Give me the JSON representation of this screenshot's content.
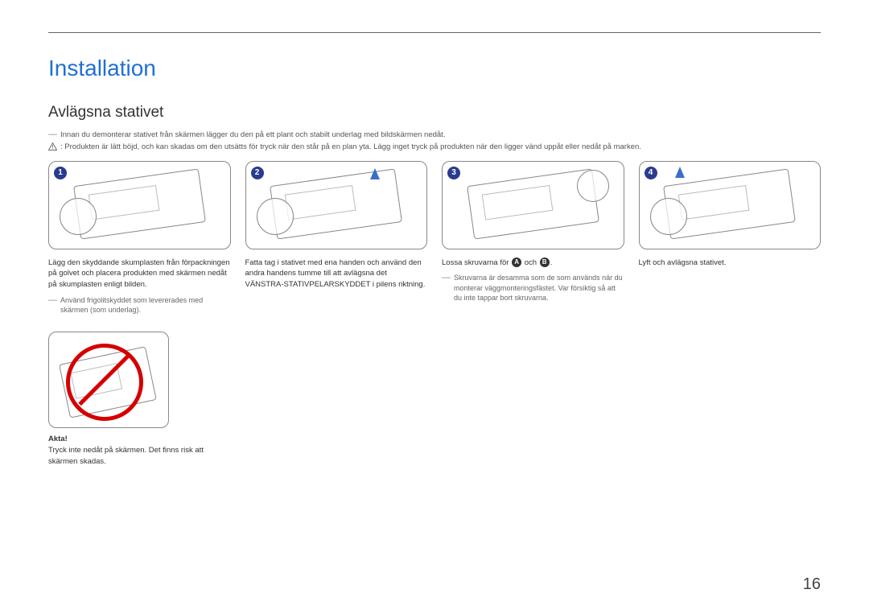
{
  "title": "Installation",
  "subtitle": "Avlägsna stativet",
  "intro_note": "Innan du demonterar stativet från skärmen lägger du den på ett plant och stabilt underlag med bildskärmen nedåt.",
  "intro_warning": ": Produkten är lätt böjd, och kan skadas om den utsätts för tryck när den står på en plan yta. Lägg inget tryck på produkten när den ligger vänd uppåt eller nedåt på marken.",
  "steps": {
    "s1": {
      "num": "1",
      "text": "Lägg den skyddande skumplasten från förpackningen på golvet och placera produkten med skärmen nedåt på skumplasten enligt bilden.",
      "note": "Använd frigolitskyddet som levererades med skärmen (som underlag)."
    },
    "s2": {
      "num": "2",
      "text": "Fatta tag i stativet med ena handen och använd den andra handens tumme till att avlägsna det VÄNSTRA-STATIVPELARSKYDDET i pilens riktning."
    },
    "s3": {
      "num": "3",
      "text_before": "Lossa skruvarna för ",
      "a": "A",
      "mid": " och ",
      "b": "B",
      "text_after": ".",
      "note": "Skruvarna är desamma som de som används när du monterar väggmonteringsfästet. Var försiktig så att du inte tappar bort skruvarna."
    },
    "s4": {
      "num": "4",
      "text": "Lyft och avlägsna stativet."
    }
  },
  "caution": {
    "label": "Akta!",
    "text": "Tryck inte nedåt på skärmen. Det finns risk att skärmen skadas."
  },
  "page_number": "16"
}
